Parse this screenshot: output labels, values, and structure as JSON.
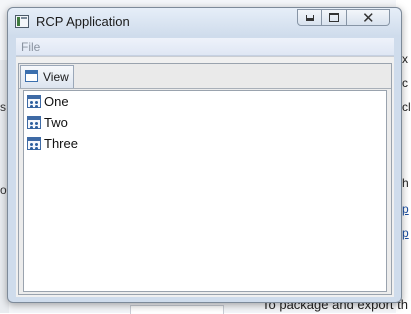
{
  "window": {
    "title": "RCP Application",
    "icon": "app-window-icon",
    "controls": {
      "minimize": "minimize-icon",
      "maximize": "maximize-icon",
      "close": "close-icon"
    }
  },
  "menubar": {
    "items": [
      {
        "label": "File"
      }
    ]
  },
  "view": {
    "tab_label": "View",
    "tab_icon": "view-icon",
    "items": [
      {
        "label": "One",
        "icon": "element-icon"
      },
      {
        "label": "Two",
        "icon": "element-icon"
      },
      {
        "label": "Three",
        "icon": "element-icon"
      }
    ]
  },
  "background": {
    "left_glyphs": [
      "s",
      "o"
    ],
    "right_glyphs": [
      "x",
      "c",
      "cl",
      "h",
      "p",
      "p"
    ],
    "bottom_text": "To package and export th"
  },
  "colors": {
    "window_frame": "#cfdcec",
    "menubar": "#dfe7f4",
    "client": "#f0f0f0",
    "list_background": "#ffffff",
    "link": "#1a4fa3"
  }
}
